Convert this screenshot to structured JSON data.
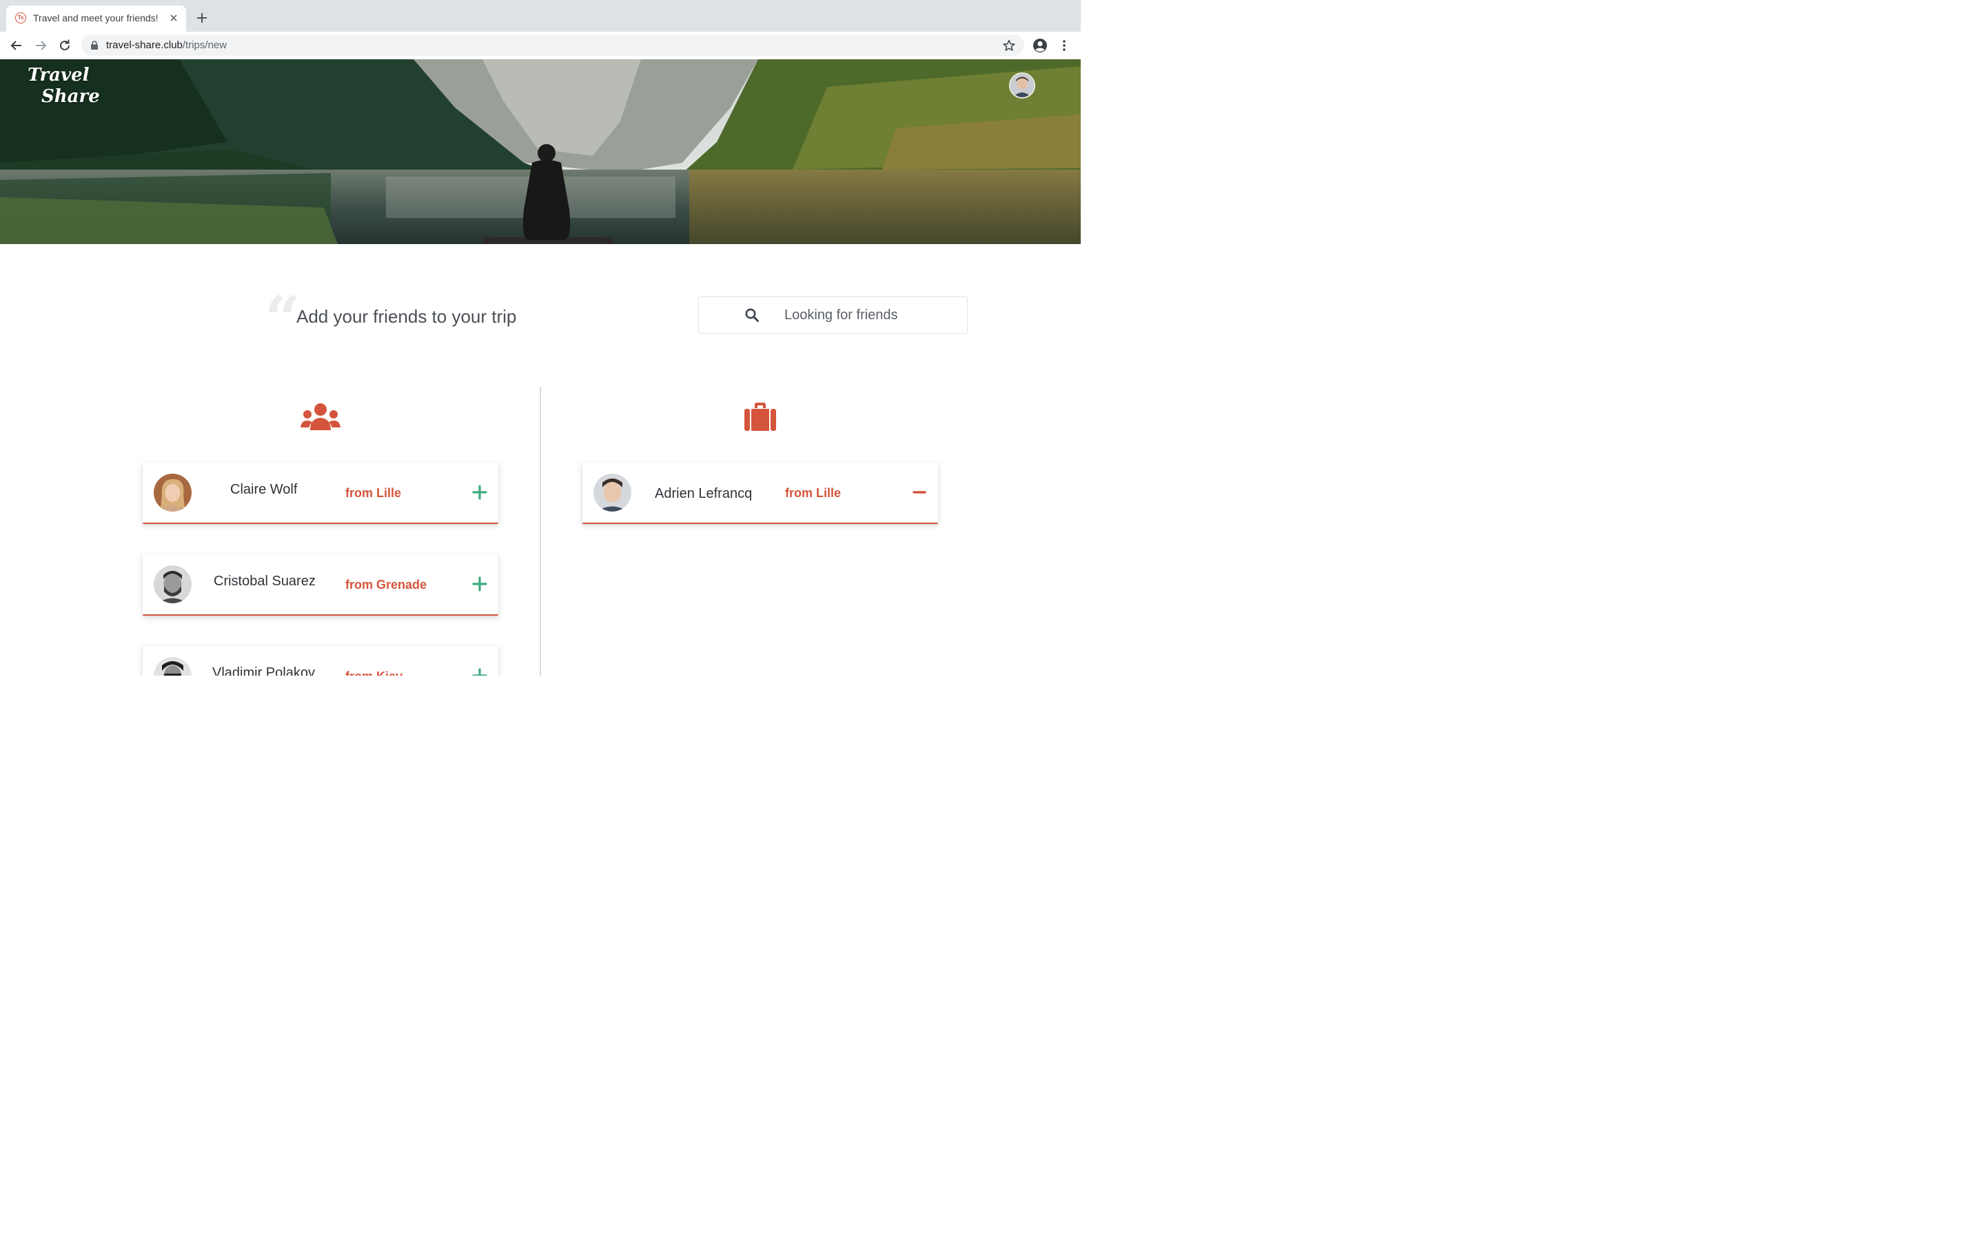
{
  "browser": {
    "tab_title": "Travel and meet your friends!",
    "favicon_text": "Ts",
    "url_host": "travel-share.club",
    "url_path": "/trips/new"
  },
  "header": {
    "logo_line1": "Travel",
    "logo_line2": "Share"
  },
  "main": {
    "title": "Add your friends to your trip",
    "quote_glyph": "“",
    "search": {
      "placeholder": "Looking for friends",
      "value": ""
    }
  },
  "friends": [
    {
      "name": "Claire Wolf",
      "from": "from Lille",
      "action": "add"
    },
    {
      "name": "Cristobal Suarez",
      "from": "from Grenade",
      "action": "add"
    },
    {
      "name": "Vladimir Polakov",
      "from": "from Kiev",
      "action": "add"
    }
  ],
  "trip_members": [
    {
      "name": "Adrien Lefrancq",
      "from": "from Lille",
      "action": "remove"
    }
  ],
  "icons": {
    "friends_column": "users-icon",
    "trip_column": "suitcase-icon",
    "add": "plus-icon",
    "remove": "minus-icon"
  },
  "colors": {
    "accent": "#d4553c",
    "add": "#3dab7b",
    "text": "#2f3338",
    "muted_text": "#4a4f55"
  }
}
